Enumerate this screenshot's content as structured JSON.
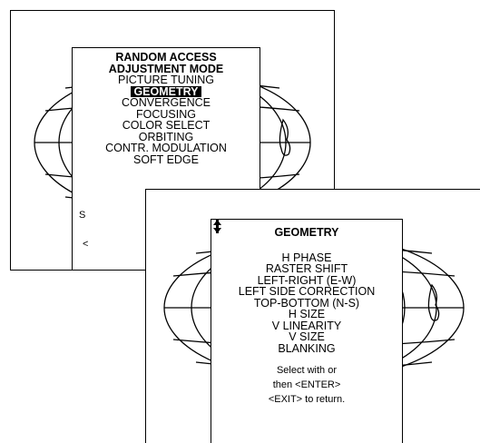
{
  "screen1": {
    "title_line1": "RANDOM ACCESS",
    "title_line2": "ADJUSTMENT MODE",
    "items": [
      {
        "label": "PICTURE TUNING",
        "selected": false
      },
      {
        "label": "GEOMETRY",
        "selected": true
      },
      {
        "label": "CONVERGENCE",
        "selected": false
      },
      {
        "label": "FOCUSING",
        "selected": false
      },
      {
        "label": "COLOR SELECT",
        "selected": false
      },
      {
        "label": "ORBITING",
        "selected": false
      },
      {
        "label": "CONTR. MODULATION",
        "selected": false
      },
      {
        "label": "SOFT EDGE",
        "selected": false
      }
    ],
    "partial_select": "S",
    "partial_exit": "<"
  },
  "screen2": {
    "title": "GEOMETRY",
    "items": [
      "H PHASE",
      "RASTER SHIFT",
      "LEFT-RIGHT (E-W)",
      "LEFT SIDE CORRECTION",
      "TOP-BOTTOM (N-S)",
      "H SIZE",
      "V LINEARITY",
      "V SIZE",
      "BLANKING"
    ],
    "help_select": "Select with",
    "help_or": "or",
    "help_then": "then <ENTER>",
    "help_exit": "<EXIT> to return.",
    "icons": [
      "arrow-down-icon",
      "arrow-up-icon"
    ]
  }
}
